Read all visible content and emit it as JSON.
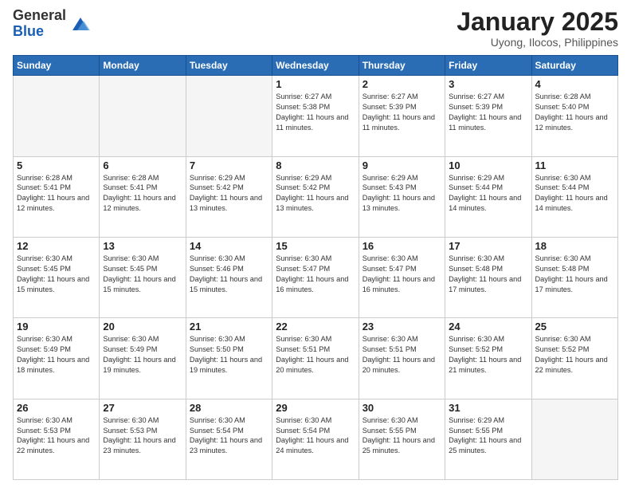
{
  "header": {
    "logo_general": "General",
    "logo_blue": "Blue",
    "title": "January 2025",
    "subtitle": "Uyong, Ilocos, Philippines"
  },
  "weekdays": [
    "Sunday",
    "Monday",
    "Tuesday",
    "Wednesday",
    "Thursday",
    "Friday",
    "Saturday"
  ],
  "weeks": [
    [
      {
        "day": "",
        "sunrise": "",
        "sunset": "",
        "daylight": ""
      },
      {
        "day": "",
        "sunrise": "",
        "sunset": "",
        "daylight": ""
      },
      {
        "day": "",
        "sunrise": "",
        "sunset": "",
        "daylight": ""
      },
      {
        "day": "1",
        "sunrise": "Sunrise: 6:27 AM",
        "sunset": "Sunset: 5:38 PM",
        "daylight": "Daylight: 11 hours and 11 minutes."
      },
      {
        "day": "2",
        "sunrise": "Sunrise: 6:27 AM",
        "sunset": "Sunset: 5:39 PM",
        "daylight": "Daylight: 11 hours and 11 minutes."
      },
      {
        "day": "3",
        "sunrise": "Sunrise: 6:27 AM",
        "sunset": "Sunset: 5:39 PM",
        "daylight": "Daylight: 11 hours and 11 minutes."
      },
      {
        "day": "4",
        "sunrise": "Sunrise: 6:28 AM",
        "sunset": "Sunset: 5:40 PM",
        "daylight": "Daylight: 11 hours and 12 minutes."
      }
    ],
    [
      {
        "day": "5",
        "sunrise": "Sunrise: 6:28 AM",
        "sunset": "Sunset: 5:41 PM",
        "daylight": "Daylight: 11 hours and 12 minutes."
      },
      {
        "day": "6",
        "sunrise": "Sunrise: 6:28 AM",
        "sunset": "Sunset: 5:41 PM",
        "daylight": "Daylight: 11 hours and 12 minutes."
      },
      {
        "day": "7",
        "sunrise": "Sunrise: 6:29 AM",
        "sunset": "Sunset: 5:42 PM",
        "daylight": "Daylight: 11 hours and 13 minutes."
      },
      {
        "day": "8",
        "sunrise": "Sunrise: 6:29 AM",
        "sunset": "Sunset: 5:42 PM",
        "daylight": "Daylight: 11 hours and 13 minutes."
      },
      {
        "day": "9",
        "sunrise": "Sunrise: 6:29 AM",
        "sunset": "Sunset: 5:43 PM",
        "daylight": "Daylight: 11 hours and 13 minutes."
      },
      {
        "day": "10",
        "sunrise": "Sunrise: 6:29 AM",
        "sunset": "Sunset: 5:44 PM",
        "daylight": "Daylight: 11 hours and 14 minutes."
      },
      {
        "day": "11",
        "sunrise": "Sunrise: 6:30 AM",
        "sunset": "Sunset: 5:44 PM",
        "daylight": "Daylight: 11 hours and 14 minutes."
      }
    ],
    [
      {
        "day": "12",
        "sunrise": "Sunrise: 6:30 AM",
        "sunset": "Sunset: 5:45 PM",
        "daylight": "Daylight: 11 hours and 15 minutes."
      },
      {
        "day": "13",
        "sunrise": "Sunrise: 6:30 AM",
        "sunset": "Sunset: 5:45 PM",
        "daylight": "Daylight: 11 hours and 15 minutes."
      },
      {
        "day": "14",
        "sunrise": "Sunrise: 6:30 AM",
        "sunset": "Sunset: 5:46 PM",
        "daylight": "Daylight: 11 hours and 15 minutes."
      },
      {
        "day": "15",
        "sunrise": "Sunrise: 6:30 AM",
        "sunset": "Sunset: 5:47 PM",
        "daylight": "Daylight: 11 hours and 16 minutes."
      },
      {
        "day": "16",
        "sunrise": "Sunrise: 6:30 AM",
        "sunset": "Sunset: 5:47 PM",
        "daylight": "Daylight: 11 hours and 16 minutes."
      },
      {
        "day": "17",
        "sunrise": "Sunrise: 6:30 AM",
        "sunset": "Sunset: 5:48 PM",
        "daylight": "Daylight: 11 hours and 17 minutes."
      },
      {
        "day": "18",
        "sunrise": "Sunrise: 6:30 AM",
        "sunset": "Sunset: 5:48 PM",
        "daylight": "Daylight: 11 hours and 17 minutes."
      }
    ],
    [
      {
        "day": "19",
        "sunrise": "Sunrise: 6:30 AM",
        "sunset": "Sunset: 5:49 PM",
        "daylight": "Daylight: 11 hours and 18 minutes."
      },
      {
        "day": "20",
        "sunrise": "Sunrise: 6:30 AM",
        "sunset": "Sunset: 5:49 PM",
        "daylight": "Daylight: 11 hours and 19 minutes."
      },
      {
        "day": "21",
        "sunrise": "Sunrise: 6:30 AM",
        "sunset": "Sunset: 5:50 PM",
        "daylight": "Daylight: 11 hours and 19 minutes."
      },
      {
        "day": "22",
        "sunrise": "Sunrise: 6:30 AM",
        "sunset": "Sunset: 5:51 PM",
        "daylight": "Daylight: 11 hours and 20 minutes."
      },
      {
        "day": "23",
        "sunrise": "Sunrise: 6:30 AM",
        "sunset": "Sunset: 5:51 PM",
        "daylight": "Daylight: 11 hours and 20 minutes."
      },
      {
        "day": "24",
        "sunrise": "Sunrise: 6:30 AM",
        "sunset": "Sunset: 5:52 PM",
        "daylight": "Daylight: 11 hours and 21 minutes."
      },
      {
        "day": "25",
        "sunrise": "Sunrise: 6:30 AM",
        "sunset": "Sunset: 5:52 PM",
        "daylight": "Daylight: 11 hours and 22 minutes."
      }
    ],
    [
      {
        "day": "26",
        "sunrise": "Sunrise: 6:30 AM",
        "sunset": "Sunset: 5:53 PM",
        "daylight": "Daylight: 11 hours and 22 minutes."
      },
      {
        "day": "27",
        "sunrise": "Sunrise: 6:30 AM",
        "sunset": "Sunset: 5:53 PM",
        "daylight": "Daylight: 11 hours and 23 minutes."
      },
      {
        "day": "28",
        "sunrise": "Sunrise: 6:30 AM",
        "sunset": "Sunset: 5:54 PM",
        "daylight": "Daylight: 11 hours and 23 minutes."
      },
      {
        "day": "29",
        "sunrise": "Sunrise: 6:30 AM",
        "sunset": "Sunset: 5:54 PM",
        "daylight": "Daylight: 11 hours and 24 minutes."
      },
      {
        "day": "30",
        "sunrise": "Sunrise: 6:30 AM",
        "sunset": "Sunset: 5:55 PM",
        "daylight": "Daylight: 11 hours and 25 minutes."
      },
      {
        "day": "31",
        "sunrise": "Sunrise: 6:29 AM",
        "sunset": "Sunset: 5:55 PM",
        "daylight": "Daylight: 11 hours and 25 minutes."
      },
      {
        "day": "",
        "sunrise": "",
        "sunset": "",
        "daylight": ""
      }
    ]
  ]
}
